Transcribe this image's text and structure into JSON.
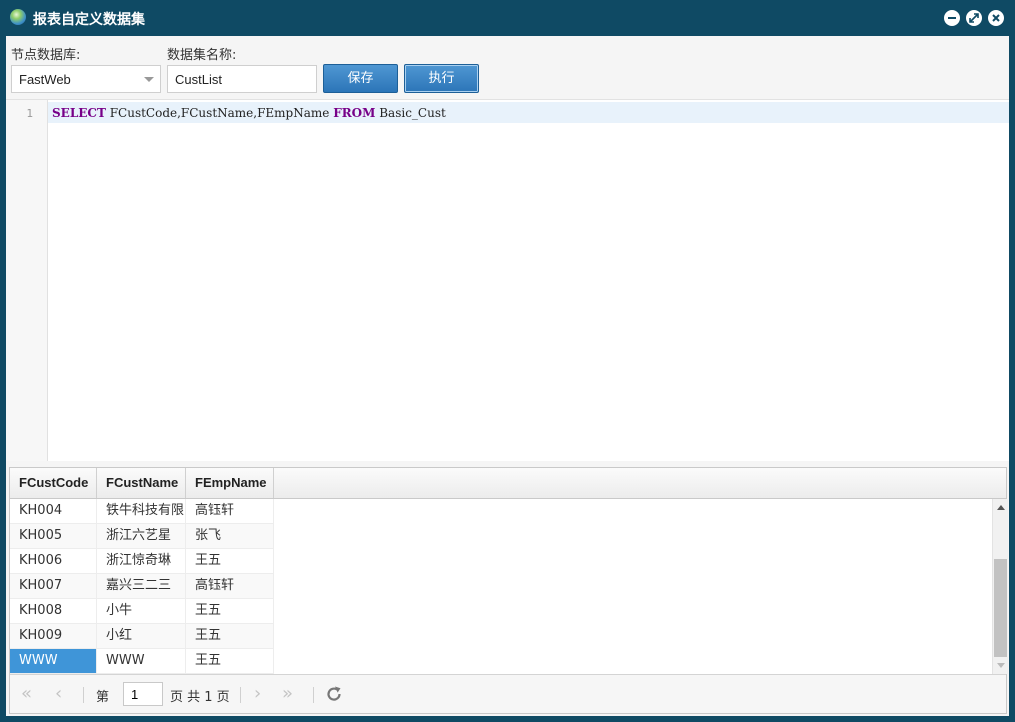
{
  "window": {
    "title": "报表自定义数据集"
  },
  "form": {
    "db_label": "节点数据库:",
    "db_value": "FastWeb",
    "name_label": "数据集名称:",
    "name_value": "CustList",
    "save_label": "保存",
    "exec_label": "执行"
  },
  "editor": {
    "line_number": "1",
    "kw_select": "SELECT",
    "columns_text": " FCustCode,FCustName,FEmpName ",
    "kw_from": "FROM",
    "table_text": " Basic_Cust"
  },
  "grid": {
    "columns": [
      "FCustCode",
      "FCustName",
      "FEmpName"
    ],
    "rows": [
      [
        "KH004",
        "铁牛科技有限",
        "高钰轩"
      ],
      [
        "KH005",
        "浙江六艺星",
        "张飞"
      ],
      [
        "KH006",
        "浙江惊奇琳",
        "王五"
      ],
      [
        "KH007",
        "嘉兴三二三",
        "高钰轩"
      ],
      [
        "KH008",
        "小牛",
        "王五"
      ],
      [
        "KH009",
        "小红",
        "王五"
      ],
      [
        "WWW",
        "WWW",
        "王五"
      ]
    ],
    "selected_row": 6
  },
  "pager": {
    "page_prefix": "第",
    "page_value": "1",
    "page_suffix": "页 共 1 页"
  },
  "icons": {
    "first": "«",
    "prev": "‹",
    "next": "›",
    "last": "»",
    "refresh": "refresh-icon"
  }
}
